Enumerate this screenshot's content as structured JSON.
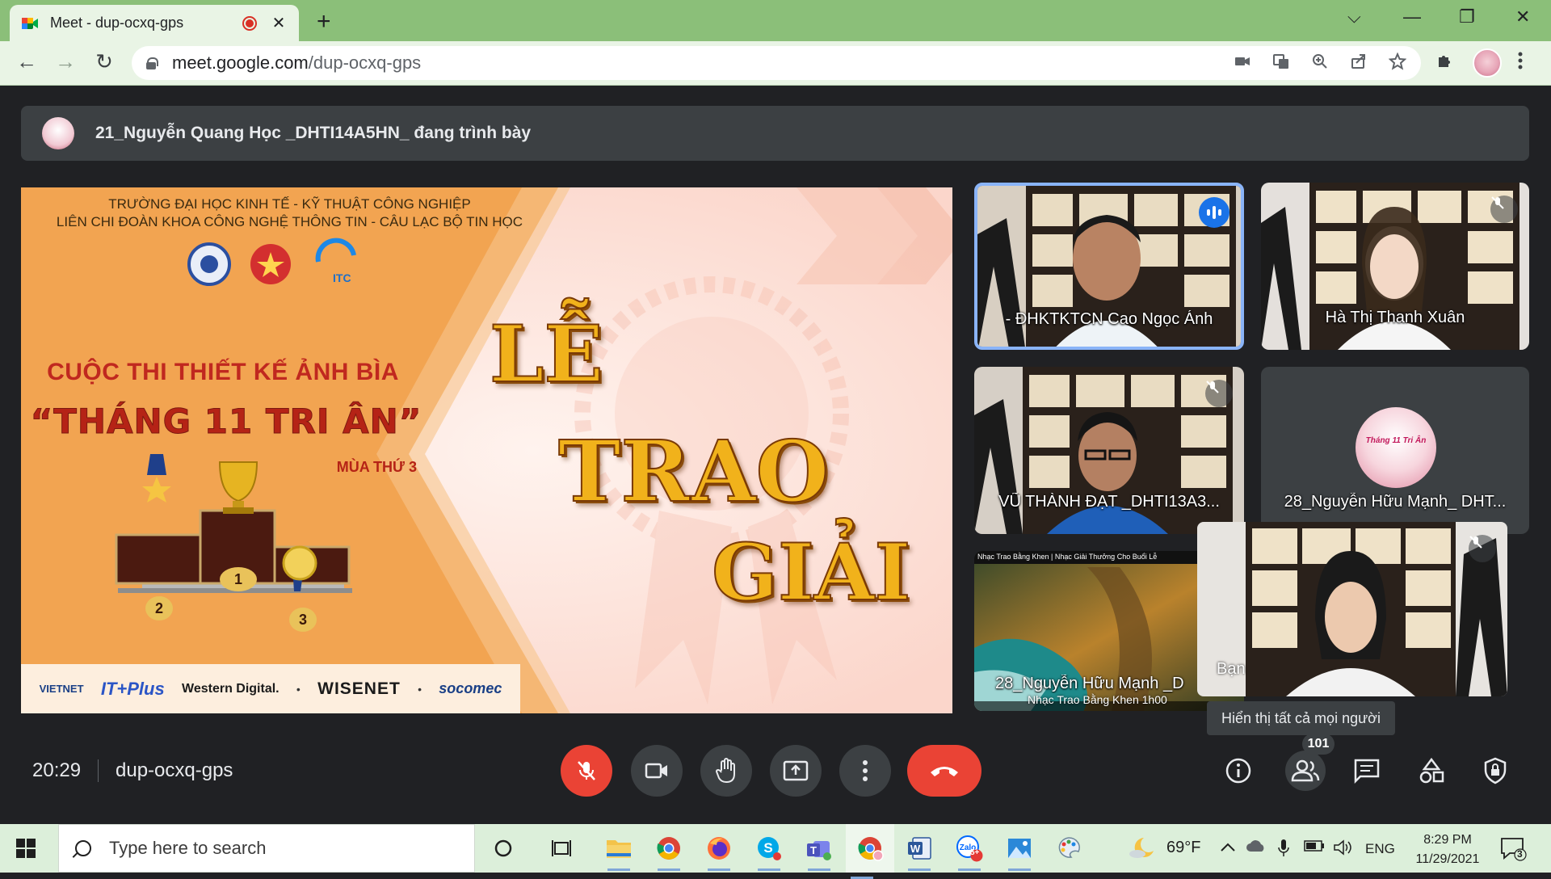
{
  "browser": {
    "tab_title": "Meet - dup-ocxq-gps",
    "tab_close": "✕",
    "new_tab": "+",
    "url_host": "meet.google.com",
    "url_path": "/dup-ocxq-gps",
    "window_controls": [
      "⌵",
      "—",
      "❐",
      "✕"
    ],
    "nav": [
      "←",
      "→",
      "↻"
    ]
  },
  "meet": {
    "presenter_text": "21_Nguyễn Quang Học _DHTI14A5HN_ đang trình bày",
    "slide": {
      "school_line1": "TRƯỜNG ĐẠI HỌC KINH TẾ - KỸ THUẬT CÔNG NGHIỆP",
      "school_line2": "LIÊN CHI ĐOÀN KHOA CÔNG NGHỆ THÔNG TIN - CÂU LẠC BỘ TIN HỌC",
      "logo_itc": "ITC",
      "contest": "CUỘC THI THIẾT KẾ ẢNH BÌA",
      "contest_name": "“THÁNG 11 TRI ÂN”",
      "season": "MÙA THỨ 3",
      "title_le": "LỄ",
      "title_trao": "TRAO",
      "title_giai": "GIẢI",
      "podium": [
        "1",
        "2",
        "3"
      ],
      "sponsors": [
        "VIETNET",
        "IT+Plus",
        "Western Digital.",
        "WISENET",
        "socomec"
      ]
    },
    "participants": [
      {
        "name": "- ĐHKTKTCN Cao Ngọc Ánh",
        "state": "speaking"
      },
      {
        "name": "Hà Thị Thanh Xuân",
        "state": "muted"
      },
      {
        "name": "VŨ THÀNH ĐẠT _DHTI13A3...",
        "state": "muted"
      },
      {
        "name": "28_Nguyễn Hữu Mạnh_ DHT...",
        "state": "avatar",
        "avatar_text": "Tháng 11 Tri Ân"
      },
      {
        "name": "28_Nguyễn Hữu Mạnh _D",
        "caption": "Nhạc Trao Bằng Khen 1h00",
        "video_header": "Nhạc Trao Bằng Khen | Nhạc Giải Thưởng Cho Buổi Lễ"
      },
      {
        "name": "Bạn",
        "state": "muted"
      }
    ],
    "tooltip": "Hiển thị tất cả mọi người",
    "time": "20:29",
    "meeting_code": "dup-ocxq-gps",
    "people_count": "101"
  },
  "taskbar": {
    "search_placeholder": "Type here to search",
    "weather": "69°F",
    "language": "ENG",
    "time": "8:29 PM",
    "date": "11/29/2021",
    "zalo_badge": "5+",
    "notifications": "3"
  },
  "colors": {
    "meet_bg": "#202124",
    "tile_bg": "#3c4043",
    "danger": "#ea4335",
    "accent": "#1a73e8",
    "chrome_green": "#8bbf79"
  }
}
